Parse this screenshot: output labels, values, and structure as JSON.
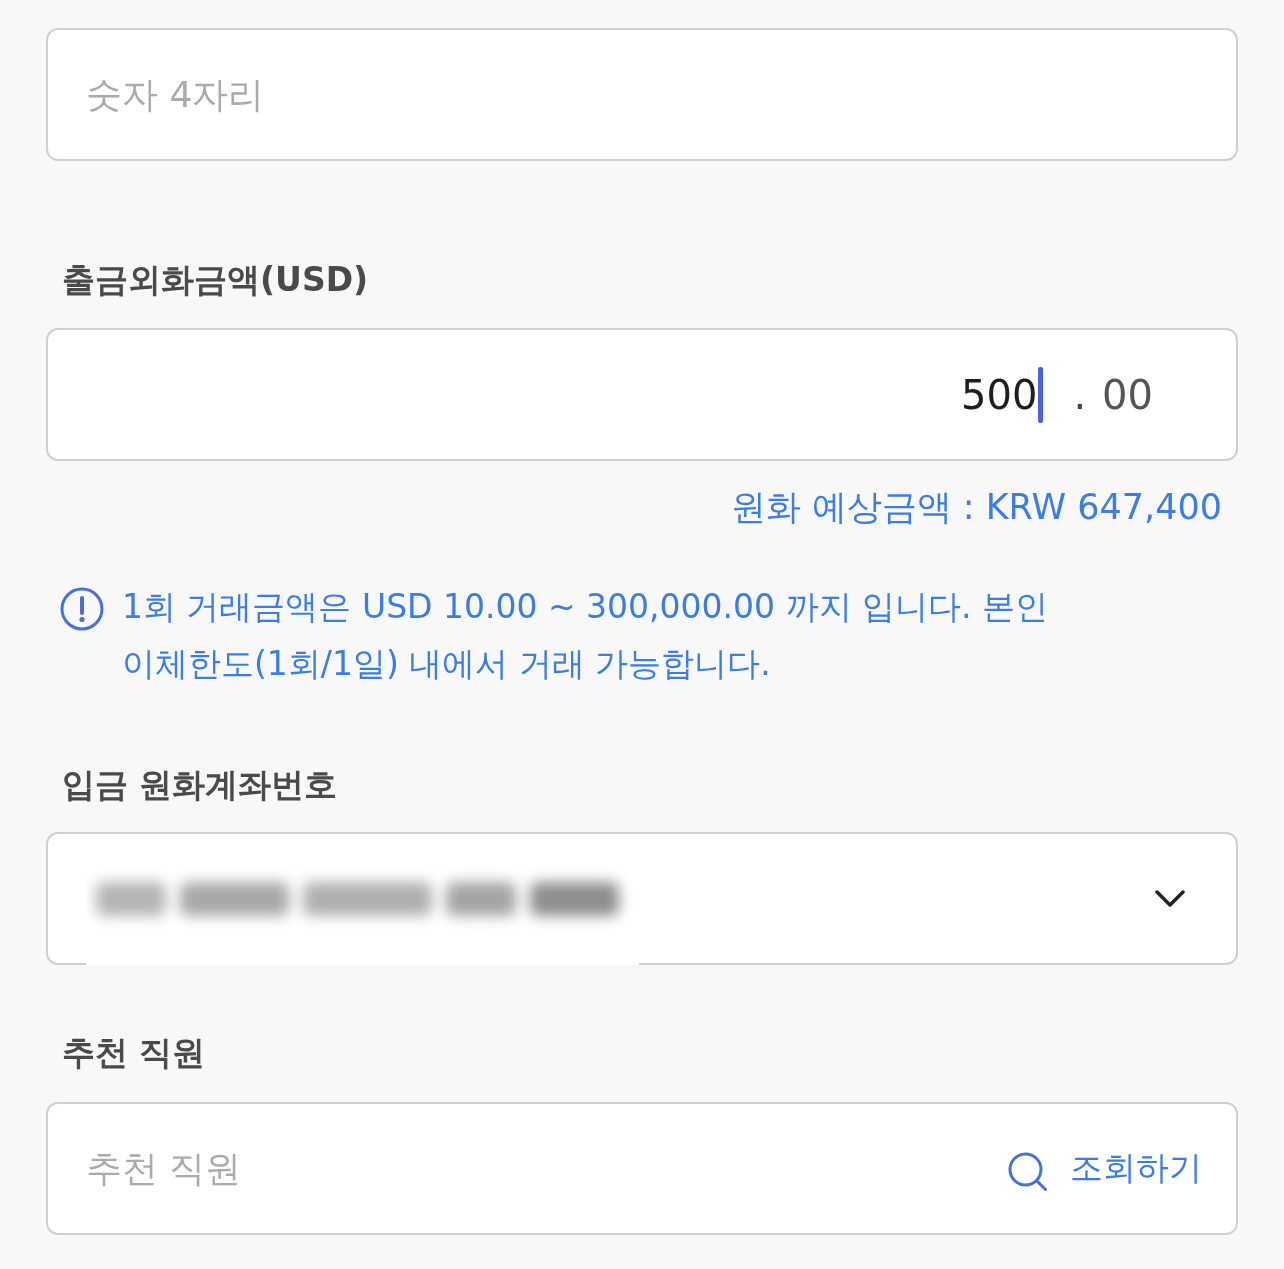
{
  "pin_field": {
    "placeholder": "숫자 4자리"
  },
  "amount": {
    "label": "출금외화금액(USD)",
    "integer_value": "500",
    "decimal_separator": ".",
    "decimal_value": "00",
    "estimate": "원화 예상금액 : KRW 647,400"
  },
  "notice": {
    "text": "1회 거래금액은 USD 10.00 ~ 300,000.00 까지 입니다. 본인 이체한도(1회/1일) 내에서 거래 가능합니다."
  },
  "deposit_account": {
    "label": "입금 원화계좌번호"
  },
  "recommender": {
    "label": "추천 직원",
    "placeholder": "추천 직원",
    "search_button": "조회하기"
  }
}
